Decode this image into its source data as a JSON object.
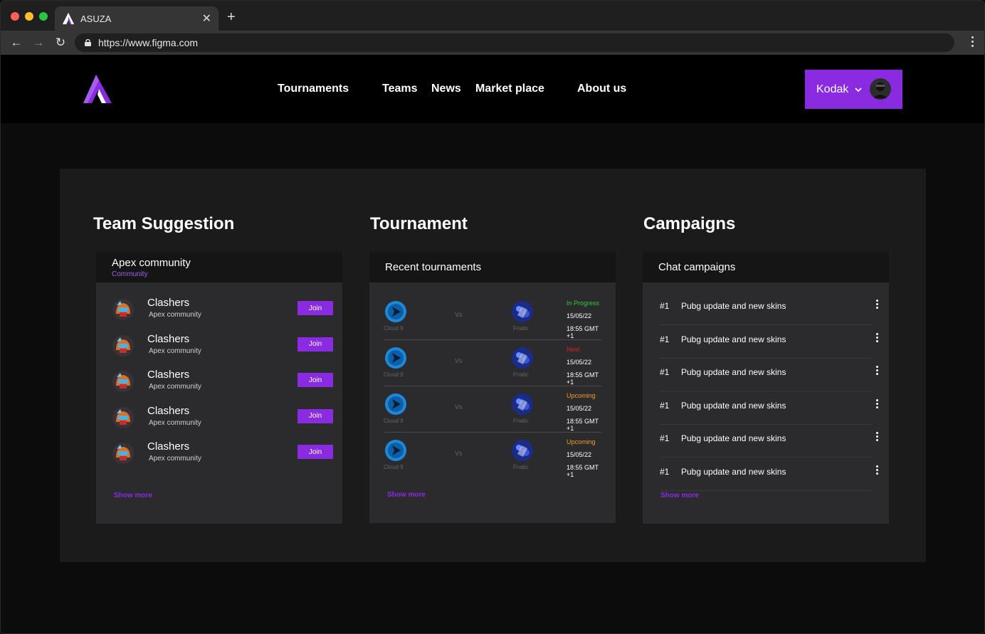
{
  "browser": {
    "tab_title": "ASUZA",
    "url": "https://www.figma.com"
  },
  "header": {
    "nav": [
      "Tournaments",
      "Teams",
      "News",
      "Market place",
      "About us"
    ],
    "user_name": "Kodak"
  },
  "colors": {
    "accent": "#8a2be2",
    "in_progress": "#2ecc40",
    "next": "#e02020",
    "upcoming": "#f0a020"
  },
  "team_suggestion": {
    "title": "Team Suggestion",
    "card_title": "Apex community",
    "card_subtitle": "Community",
    "teams": [
      {
        "name": "Clashers",
        "sub": "Apex community",
        "join": "Join"
      },
      {
        "name": "Clashers",
        "sub": "Apex community",
        "join": "Join"
      },
      {
        "name": "Clashers",
        "sub": "Apex community",
        "join": "Join"
      },
      {
        "name": "Clashers",
        "sub": "Apex community",
        "join": "Join"
      },
      {
        "name": "Clashers",
        "sub": "Apex community",
        "join": "Join"
      }
    ],
    "show_more": "Show more"
  },
  "tournament": {
    "title": "Tournament",
    "card_title": "Recent tournaments",
    "matches": [
      {
        "team1": "Cloud 9",
        "vs": "Vs",
        "team2": "Fnatic",
        "status": "In Progress",
        "status_key": "in_progress",
        "date": "15/05/22",
        "time": "18:55 GMT +1"
      },
      {
        "team1": "Cloud 9",
        "vs": "Vs",
        "team2": "Fnatic",
        "status": "Next",
        "status_key": "next",
        "date": "15/05/22",
        "time": "18:55 GMT +1"
      },
      {
        "team1": "Cloud 9",
        "vs": "Vs",
        "team2": "Fnatic",
        "status": "Upcoming",
        "status_key": "upcoming",
        "date": "15/05/22",
        "time": "18:55 GMT +1"
      },
      {
        "team1": "Cloud 9",
        "vs": "Vs",
        "team2": "Fnatic",
        "status": "Upcoming",
        "status_key": "upcoming",
        "date": "15/05/22",
        "time": "18:55 GMT +1"
      }
    ],
    "show_more": "Show more"
  },
  "campaigns": {
    "title": "Campaigns",
    "card_title": "Chat campaigns",
    "items": [
      {
        "rank": "#1",
        "text": "Pubg update and new skins"
      },
      {
        "rank": "#1",
        "text": "Pubg update and new skins"
      },
      {
        "rank": "#1",
        "text": "Pubg update and new skins"
      },
      {
        "rank": "#1",
        "text": "Pubg update and new skins"
      },
      {
        "rank": "#1",
        "text": "Pubg update and new skins"
      },
      {
        "rank": "#1",
        "text": "Pubg update and new skins"
      }
    ],
    "show_more": "Show more"
  }
}
